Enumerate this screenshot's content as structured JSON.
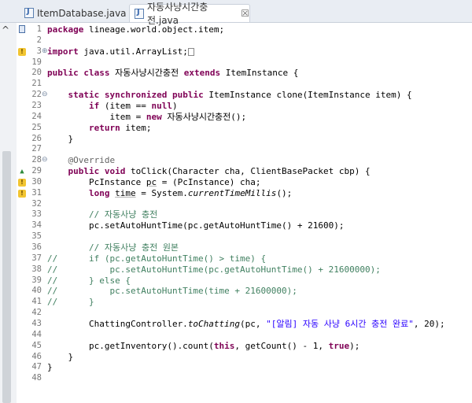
{
  "tabs": [
    {
      "label": "ItemDatabase.java",
      "active": false
    },
    {
      "label": "자동사냥시간충전.java",
      "active": true,
      "close": "☒"
    }
  ],
  "gutter": {
    "chevron": "^"
  },
  "lines": [
    {
      "n": "1",
      "marker": "box",
      "fold": "",
      "code": [
        [
          "kw",
          "package"
        ],
        [
          "",
          " lineage.world.object.item;"
        ]
      ]
    },
    {
      "n": "2",
      "marker": "",
      "fold": "",
      "code": []
    },
    {
      "n": "3",
      "marker": "warn",
      "fold": "⊕",
      "code": [
        [
          "kw",
          "import"
        ],
        [
          "",
          " java.util.ArrayList;"
        ],
        [
          "collapsed",
          ""
        ]
      ]
    },
    {
      "n": "19",
      "marker": "",
      "fold": "",
      "code": []
    },
    {
      "n": "20",
      "marker": "",
      "fold": "",
      "code": [
        [
          "kw",
          "public"
        ],
        [
          "",
          " "
        ],
        [
          "kw",
          "class"
        ],
        [
          "",
          " 자동사냥시간충전 "
        ],
        [
          "kw",
          "extends"
        ],
        [
          "",
          " ItemInstance {"
        ]
      ]
    },
    {
      "n": "21",
      "marker": "",
      "fold": "",
      "code": []
    },
    {
      "n": "22",
      "marker": "",
      "fold": "⊖",
      "code": [
        [
          "",
          "    "
        ],
        [
          "kw",
          "static"
        ],
        [
          "",
          " "
        ],
        [
          "kw",
          "synchronized"
        ],
        [
          "",
          " "
        ],
        [
          "kw",
          "public"
        ],
        [
          "",
          " ItemInstance clone(ItemInstance item) {"
        ]
      ]
    },
    {
      "n": "23",
      "marker": "",
      "fold": "",
      "code": [
        [
          "",
          "        "
        ],
        [
          "kw",
          "if"
        ],
        [
          "",
          " (item == "
        ],
        [
          "kw",
          "null"
        ],
        [
          "",
          ")"
        ]
      ]
    },
    {
      "n": "24",
      "marker": "",
      "fold": "",
      "code": [
        [
          "",
          "            item = "
        ],
        [
          "kw",
          "new"
        ],
        [
          "",
          " 자동사냥시간충전();"
        ]
      ]
    },
    {
      "n": "25",
      "marker": "",
      "fold": "",
      "code": [
        [
          "",
          "        "
        ],
        [
          "kw",
          "return"
        ],
        [
          "",
          " item;"
        ]
      ]
    },
    {
      "n": "26",
      "marker": "",
      "fold": "",
      "code": [
        [
          "",
          "    }"
        ]
      ]
    },
    {
      "n": "27",
      "marker": "",
      "fold": "",
      "code": []
    },
    {
      "n": "28",
      "marker": "",
      "fold": "⊖",
      "code": [
        [
          "",
          "    "
        ],
        [
          "an",
          "@Override"
        ]
      ]
    },
    {
      "n": "29",
      "marker": "override",
      "fold": "",
      "code": [
        [
          "",
          "    "
        ],
        [
          "kw",
          "public"
        ],
        [
          "",
          " "
        ],
        [
          "kw",
          "void"
        ],
        [
          "",
          " toClick(Character cha, ClientBasePacket cbp) {"
        ]
      ]
    },
    {
      "n": "30",
      "marker": "warn",
      "fold": "",
      "code": [
        [
          "",
          "        PcInstance "
        ],
        [
          "uline",
          "pc"
        ],
        [
          "",
          " = (PcInstance) cha;"
        ]
      ]
    },
    {
      "n": "31",
      "marker": "warn",
      "fold": "",
      "code": [
        [
          "",
          "        "
        ],
        [
          "kw",
          "long"
        ],
        [
          "",
          " "
        ],
        [
          "uline",
          "time"
        ],
        [
          "",
          " = System."
        ],
        [
          "it",
          "currentTimeMillis"
        ],
        [
          "",
          "();"
        ]
      ]
    },
    {
      "n": "32",
      "marker": "",
      "fold": "",
      "code": []
    },
    {
      "n": "33",
      "marker": "",
      "fold": "",
      "code": [
        [
          "",
          "        "
        ],
        [
          "cm",
          "// 자동사냥 충전"
        ]
      ]
    },
    {
      "n": "34",
      "marker": "",
      "fold": "",
      "code": [
        [
          "",
          "        pc.setAutoHuntTime(pc.getAutoHuntTime() + 21600);"
        ]
      ]
    },
    {
      "n": "35",
      "marker": "",
      "fold": "",
      "code": []
    },
    {
      "n": "36",
      "marker": "",
      "fold": "",
      "code": [
        [
          "",
          "        "
        ],
        [
          "cm",
          "// 자동사냥 충전 원본"
        ]
      ]
    },
    {
      "n": "37",
      "marker": "",
      "fold": "",
      "code": [
        [
          "cm",
          "//      if (pc.getAutoHuntTime() > time) {"
        ]
      ]
    },
    {
      "n": "38",
      "marker": "",
      "fold": "",
      "code": [
        [
          "cm",
          "//          pc.setAutoHuntTime(pc.getAutoHuntTime() + 21600000);"
        ]
      ]
    },
    {
      "n": "39",
      "marker": "",
      "fold": "",
      "code": [
        [
          "cm",
          "//      } else {"
        ]
      ]
    },
    {
      "n": "40",
      "marker": "",
      "fold": "",
      "code": [
        [
          "cm",
          "//          pc.setAutoHuntTime(time + 21600000);"
        ]
      ]
    },
    {
      "n": "41",
      "marker": "",
      "fold": "",
      "code": [
        [
          "cm",
          "//      }"
        ]
      ]
    },
    {
      "n": "42",
      "marker": "",
      "fold": "",
      "code": []
    },
    {
      "n": "43",
      "marker": "",
      "fold": "",
      "code": [
        [
          "",
          "        ChattingController."
        ],
        [
          "it",
          "toChatting"
        ],
        [
          "",
          "(pc, "
        ],
        [
          "st",
          "\"[알림] 자동 사냥 6시간 충전 완료\""
        ],
        [
          "",
          ", 20);"
        ]
      ]
    },
    {
      "n": "44",
      "marker": "",
      "fold": "",
      "code": []
    },
    {
      "n": "45",
      "marker": "",
      "fold": "",
      "code": [
        [
          "",
          "        pc.getInventory().count("
        ],
        [
          "kw",
          "this"
        ],
        [
          "",
          ", getCount() - 1, "
        ],
        [
          "kw",
          "true"
        ],
        [
          "",
          ");"
        ]
      ]
    },
    {
      "n": "46",
      "marker": "",
      "fold": "",
      "code": [
        [
          "",
          "    }"
        ]
      ]
    },
    {
      "n": "47",
      "marker": "",
      "fold": "",
      "code": [
        [
          "",
          "}"
        ]
      ]
    },
    {
      "n": "48",
      "marker": "",
      "fold": "",
      "code": []
    }
  ]
}
